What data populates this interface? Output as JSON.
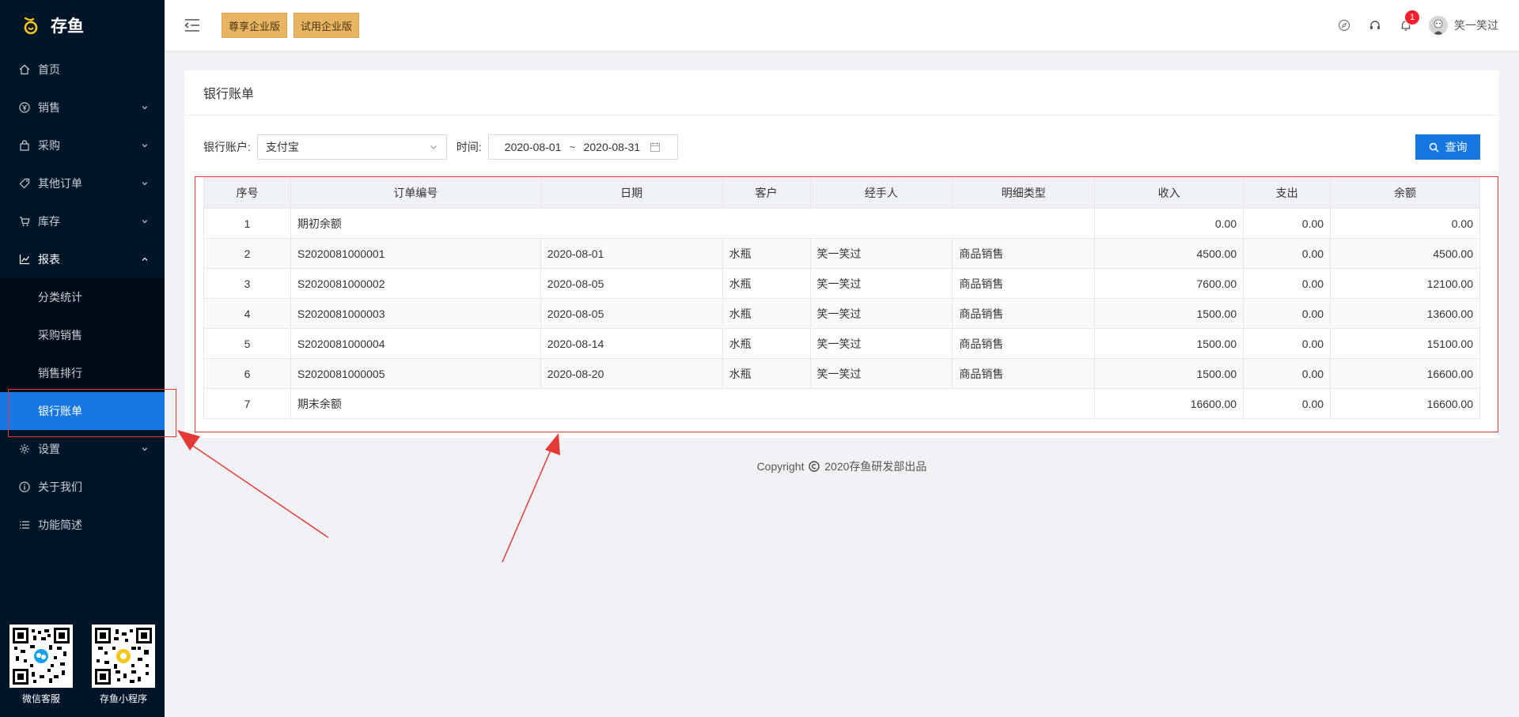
{
  "app": {
    "name": "存鱼"
  },
  "sidebar": {
    "items": [
      {
        "label": "首页",
        "icon": "home-icon"
      },
      {
        "label": "销售",
        "icon": "yen-circle-icon"
      },
      {
        "label": "采购",
        "icon": "bag-icon"
      },
      {
        "label": "其他订单",
        "icon": "tag-icon"
      },
      {
        "label": "库存",
        "icon": "cart-icon"
      },
      {
        "label": "报表",
        "icon": "chart-icon"
      },
      {
        "label": "设置",
        "icon": "gear-icon"
      },
      {
        "label": "关于我们",
        "icon": "info-icon"
      },
      {
        "label": "功能简述",
        "icon": "list-icon"
      }
    ],
    "report_sub": [
      {
        "label": "分类统计"
      },
      {
        "label": "采购销售"
      },
      {
        "label": "销售排行"
      },
      {
        "label": "银行账单"
      }
    ],
    "qr": [
      {
        "label": "微信客服"
      },
      {
        "label": "存鱼小程序"
      }
    ]
  },
  "header": {
    "editions": [
      "尊享企业版",
      "试用企业版"
    ],
    "notification_count": "1",
    "user_name": "笑一笑过"
  },
  "page": {
    "title": "银行账单",
    "filter": {
      "account_label": "银行账户:",
      "account_value": "支付宝",
      "time_label": "时间:",
      "start_date": "2020-08-01",
      "range_sep": "~",
      "end_date": "2020-08-31",
      "query_label": "查询"
    },
    "table": {
      "headers": [
        "序号",
        "订单编号",
        "日期",
        "客户",
        "经手人",
        "明细类型",
        "收入",
        "支出",
        "余额"
      ],
      "opening": {
        "no": "1",
        "label": "期初余额",
        "income": "0.00",
        "expense": "0.00",
        "balance": "0.00"
      },
      "rows": [
        {
          "no": "2",
          "order": "S2020081000001",
          "date": "2020-08-01",
          "customer": "水瓶",
          "handler": "笑一笑过",
          "type": "商品销售",
          "income": "4500.00",
          "expense": "0.00",
          "balance": "4500.00"
        },
        {
          "no": "3",
          "order": "S2020081000002",
          "date": "2020-08-05",
          "customer": "水瓶",
          "handler": "笑一笑过",
          "type": "商品销售",
          "income": "7600.00",
          "expense": "0.00",
          "balance": "12100.00"
        },
        {
          "no": "4",
          "order": "S2020081000003",
          "date": "2020-08-05",
          "customer": "水瓶",
          "handler": "笑一笑过",
          "type": "商品销售",
          "income": "1500.00",
          "expense": "0.00",
          "balance": "13600.00"
        },
        {
          "no": "5",
          "order": "S2020081000004",
          "date": "2020-08-14",
          "customer": "水瓶",
          "handler": "笑一笑过",
          "type": "商品销售",
          "income": "1500.00",
          "expense": "0.00",
          "balance": "15100.00"
        },
        {
          "no": "6",
          "order": "S2020081000005",
          "date": "2020-08-20",
          "customer": "水瓶",
          "handler": "笑一笑过",
          "type": "商品销售",
          "income": "1500.00",
          "expense": "0.00",
          "balance": "16600.00"
        }
      ],
      "closing": {
        "no": "7",
        "label": "期末余额",
        "income": "16600.00",
        "expense": "0.00",
        "balance": "16600.00"
      }
    }
  },
  "footer": {
    "copyright": "Copyright",
    "text": "2020存鱼研发部出品"
  },
  "colors": {
    "sidebar_bg": "#011529",
    "accent": "#1677e0",
    "edition_bg": "#e8b662",
    "annotation": "#e53935"
  }
}
